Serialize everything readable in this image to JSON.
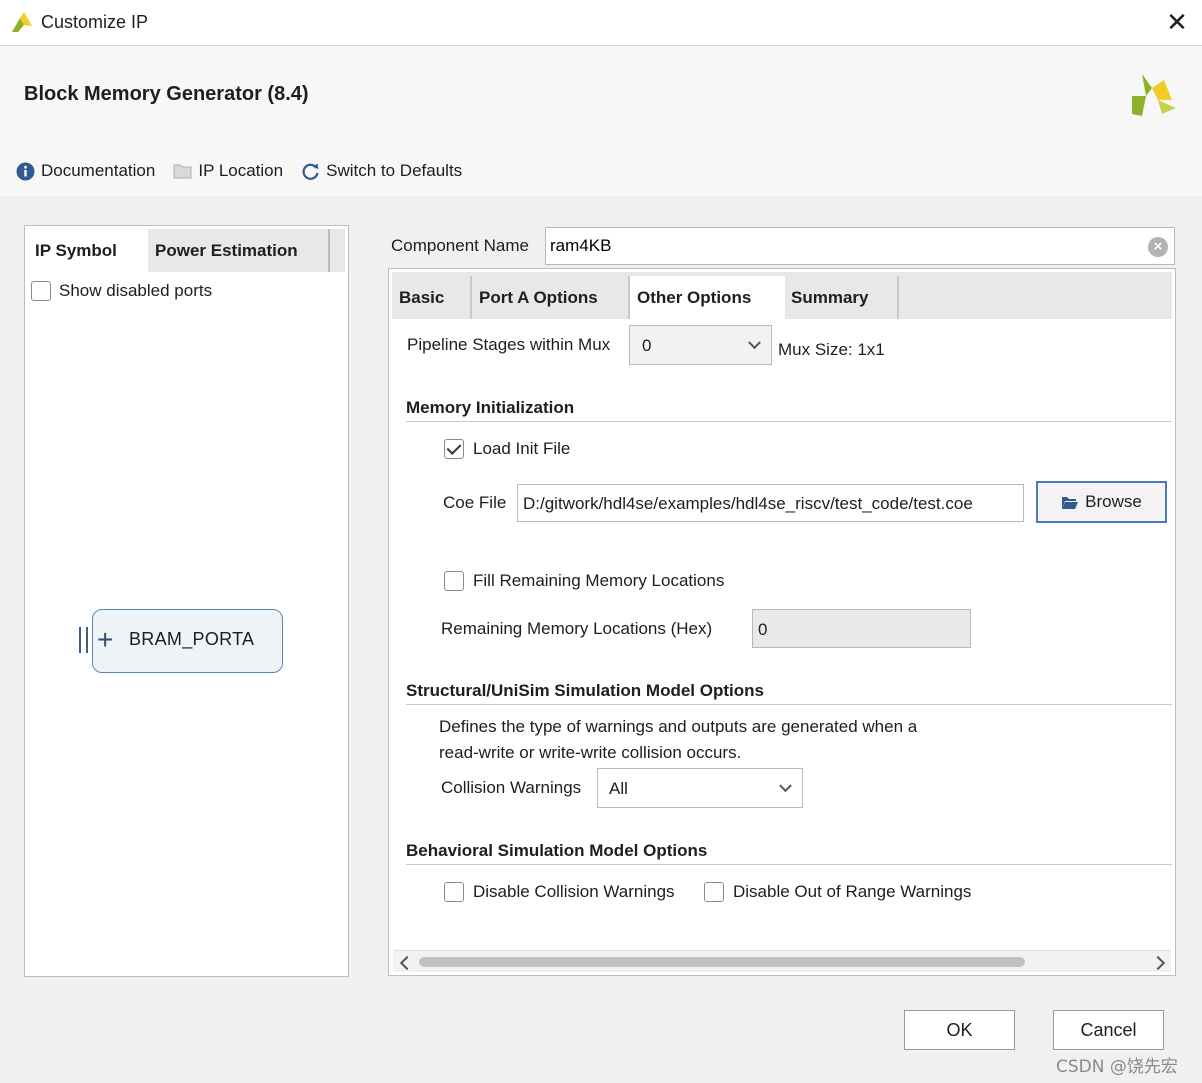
{
  "window": {
    "title": "Customize IP",
    "close_glyph": "✕"
  },
  "header": {
    "ip_name": "Block Memory Generator (8.4)",
    "logo_icon": "xilinx-logo-icon",
    "toolbar": {
      "documentation": "Documentation",
      "ip_location": "IP Location",
      "switch_defaults": "Switch to Defaults"
    }
  },
  "left_panel": {
    "tabs": [
      "IP Symbol",
      "Power Estimation"
    ],
    "active_tab": "IP Symbol",
    "show_disabled_ports": {
      "label": "Show disabled ports",
      "checked": false
    },
    "symbol": {
      "port_label": "BRAM_PORTA",
      "expand_glyph": "+"
    }
  },
  "component": {
    "label": "Component Name",
    "value": "ram4KB"
  },
  "right_panel": {
    "tabs": [
      "Basic",
      "Port A Options",
      "Other Options",
      "Summary"
    ],
    "active_tab": "Other Options",
    "pipeline": {
      "label": "Pipeline Stages within Mux",
      "value": "0",
      "mux_size": "Mux Size: 1x1"
    },
    "memory_init": {
      "title": "Memory Initialization",
      "load_init": {
        "label": "Load Init File",
        "checked": true
      },
      "coe_label": "Coe File",
      "coe_value": "D:/gitwork/hdl4se/examples/hdl4se_riscv/test_code/test.coe",
      "browse_label": "Browse",
      "fill_remaining": {
        "label": "Fill Remaining Memory Locations",
        "checked": false
      },
      "remaining_label": "Remaining Memory Locations (Hex)",
      "remaining_value": "0"
    },
    "structural": {
      "title": "Structural/UniSim Simulation Model Options",
      "desc_line1": "Defines the type of warnings and outputs are generated when a",
      "desc_line2": "read-write or write-write collision occurs.",
      "collision_label": "Collision Warnings",
      "collision_value": "All"
    },
    "behavioral": {
      "title": "Behavioral Simulation Model Options",
      "disable_collision": {
        "label": "Disable Collision Warnings",
        "checked": false
      },
      "disable_range": {
        "label": "Disable Out of Range Warnings",
        "checked": false
      }
    }
  },
  "footer": {
    "ok": "OK",
    "cancel": "Cancel",
    "watermark": "CSDN @饶先宏"
  },
  "colors": {
    "accent_border": "#4a7ab8",
    "xilinx_green": "#8fb02a",
    "xilinx_yellow": "#f3cc27"
  }
}
